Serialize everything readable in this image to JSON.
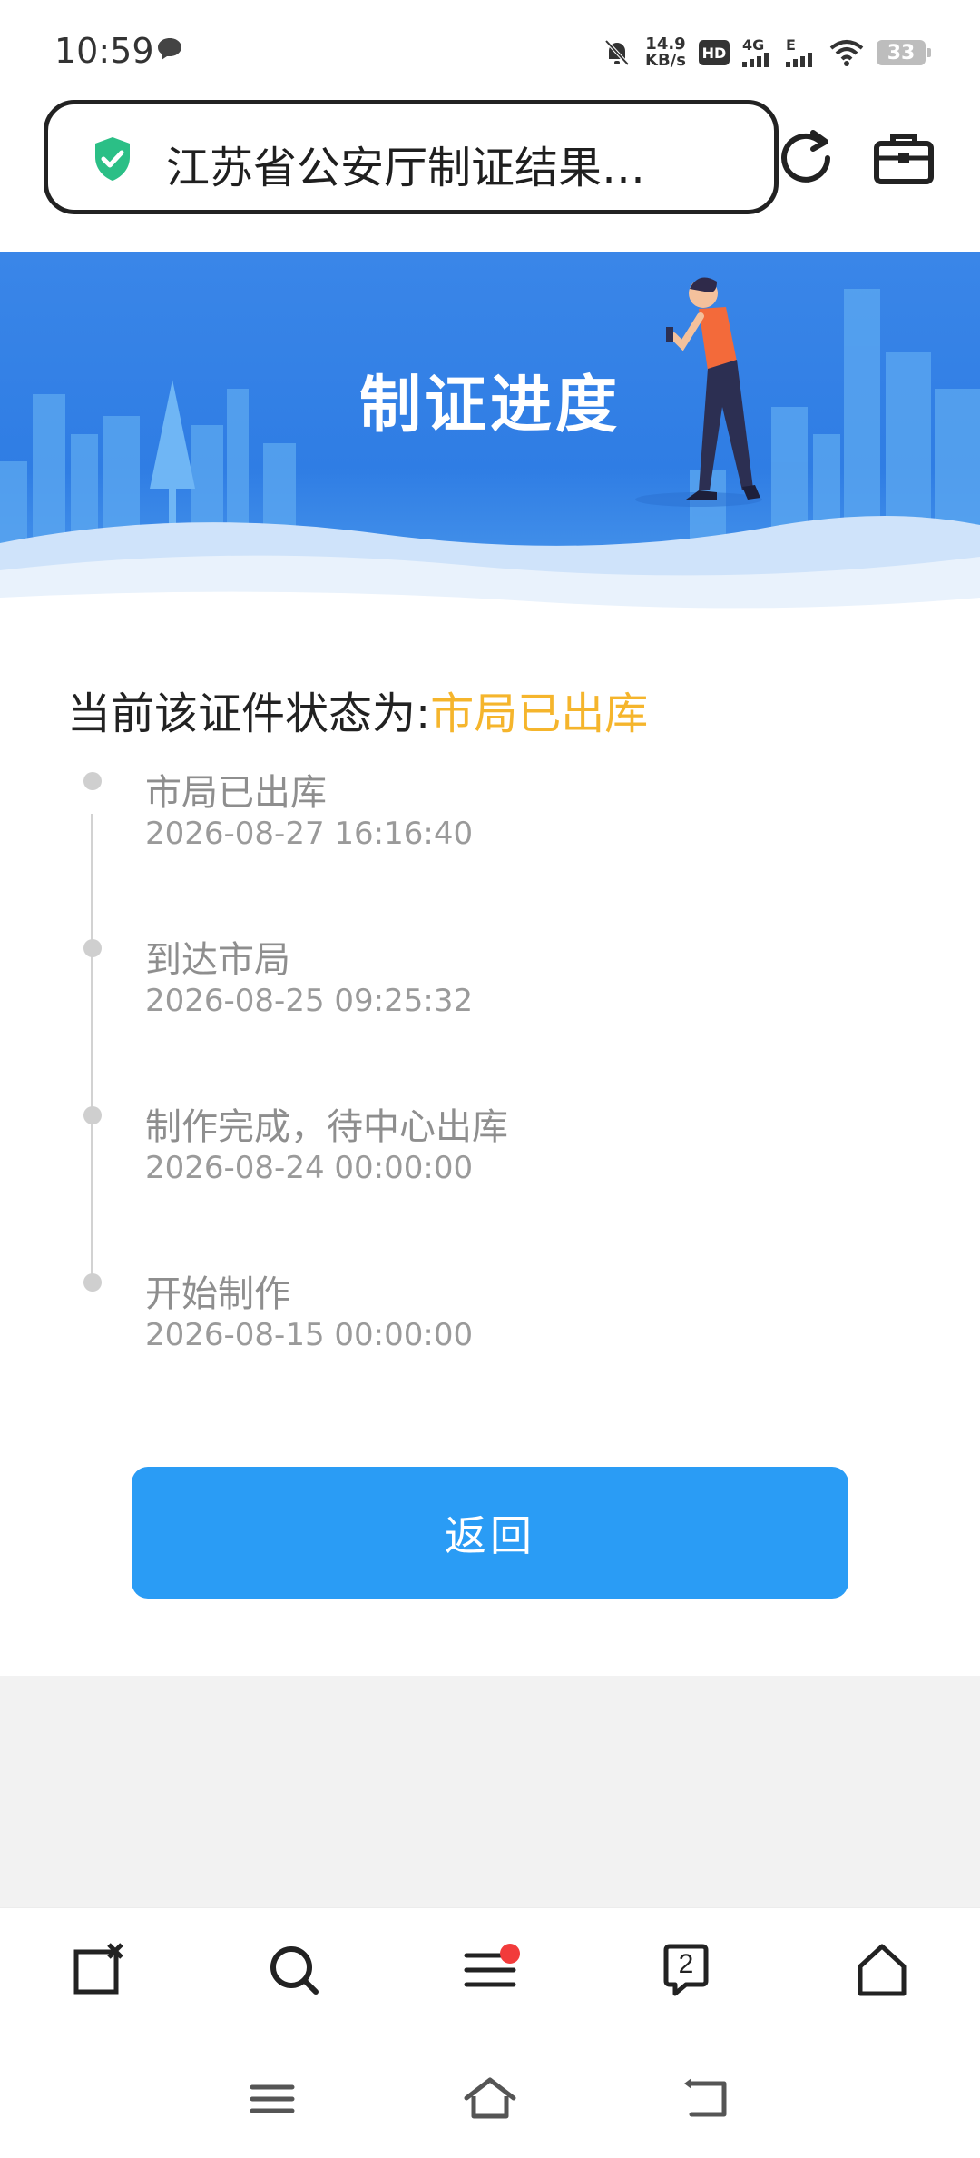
{
  "status_bar": {
    "time": "10:59",
    "net_speed_value": "14.9",
    "net_speed_unit": "KB/s",
    "hd_label": "HD",
    "network_4g": "4G",
    "network_e": "E",
    "battery": "33"
  },
  "browser": {
    "page_title": "江苏省公安厅制证结果…"
  },
  "banner": {
    "title": "制证进度"
  },
  "status": {
    "label": "当前该证件状态为:",
    "value": "市局已出库",
    "value_color": "#f5b52c"
  },
  "timeline": [
    {
      "title": "市局已出库",
      "time": "2026-08-27 16:16:40"
    },
    {
      "title": "到达市局",
      "time": "2026-08-25 09:25:32"
    },
    {
      "title": "制作完成，待中心出库",
      "time": "2026-08-24 00:00:00"
    },
    {
      "title": "开始制作",
      "time": "2026-08-15 00:00:00"
    }
  ],
  "return_button": {
    "label": "返回",
    "color": "#2a9cf5"
  },
  "toolbar": {
    "tab_count": "2",
    "icons": [
      "close-tab-icon",
      "search-icon",
      "menu-icon",
      "tabs-icon",
      "home-icon"
    ]
  },
  "system_nav": {
    "icons": [
      "recent-apps-icon",
      "home-icon",
      "back-icon"
    ]
  }
}
